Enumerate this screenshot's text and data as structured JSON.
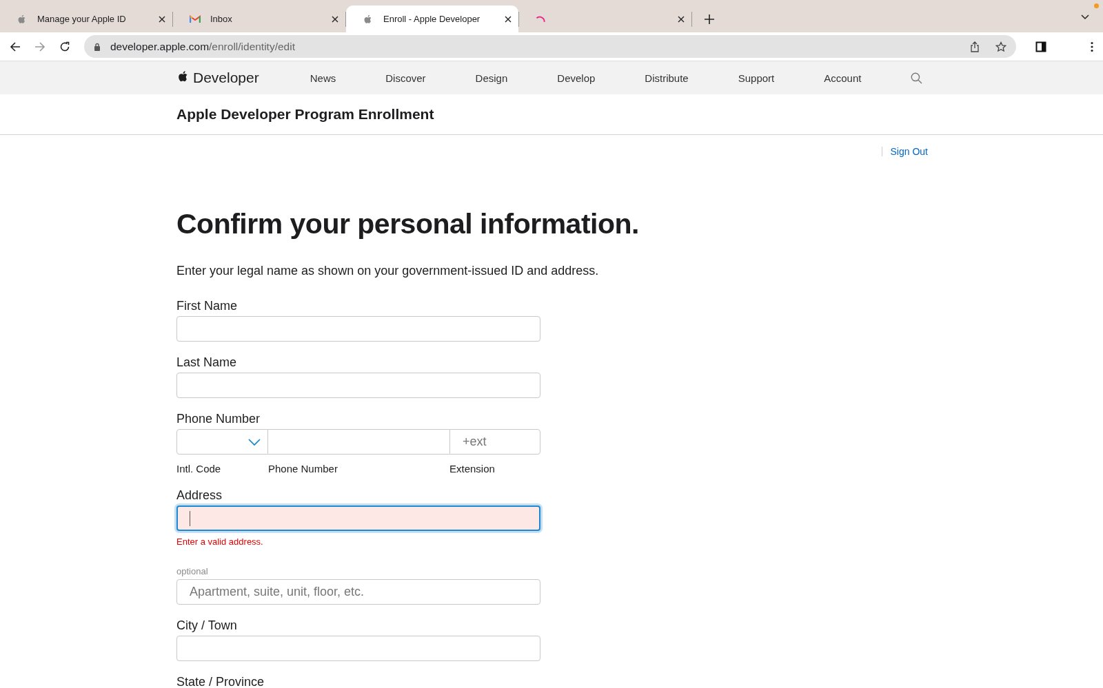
{
  "browser": {
    "tabs": [
      {
        "title": "Manage your Apple ID",
        "kind": "apple",
        "selected": false
      },
      {
        "title": "Inbox",
        "kind": "mail",
        "selected": false
      },
      {
        "title": "Enroll - Apple Developer",
        "kind": "apple",
        "selected": true
      },
      {
        "kind": "loading",
        "selected": false
      }
    ],
    "url": {
      "host": "developer.apple.com",
      "path": "/enroll/identity/edit"
    }
  },
  "site_nav": {
    "logo": "Developer",
    "items": [
      "News",
      "Discover",
      "Design",
      "Develop",
      "Distribute",
      "Support",
      "Account"
    ]
  },
  "page_title": "Apple Developer Program Enrollment",
  "sign_out": "Sign Out",
  "heading": "Confirm your personal information.",
  "intro": "Enter your legal name as shown on your government-issued ID and address.",
  "fields": [
    {
      "kind": "text",
      "label": "First Name"
    },
    {
      "kind": "text",
      "label": "Last Name"
    },
    {
      "kind": "phone",
      "label": "Phone Number",
      "ext_placeholder": "+ext",
      "sublabels": [
        "Intl. Code",
        "Phone Number",
        "Extension"
      ]
    },
    {
      "kind": "text",
      "label": "Address",
      "focused": true,
      "error": "Enter a valid address."
    },
    {
      "kind": "text",
      "note": "optional",
      "placeholder": "Apartment, suite, unit, floor, etc."
    },
    {
      "kind": "text",
      "label": "City / Town"
    },
    {
      "kind": "text",
      "label": "State / Province"
    }
  ]
}
